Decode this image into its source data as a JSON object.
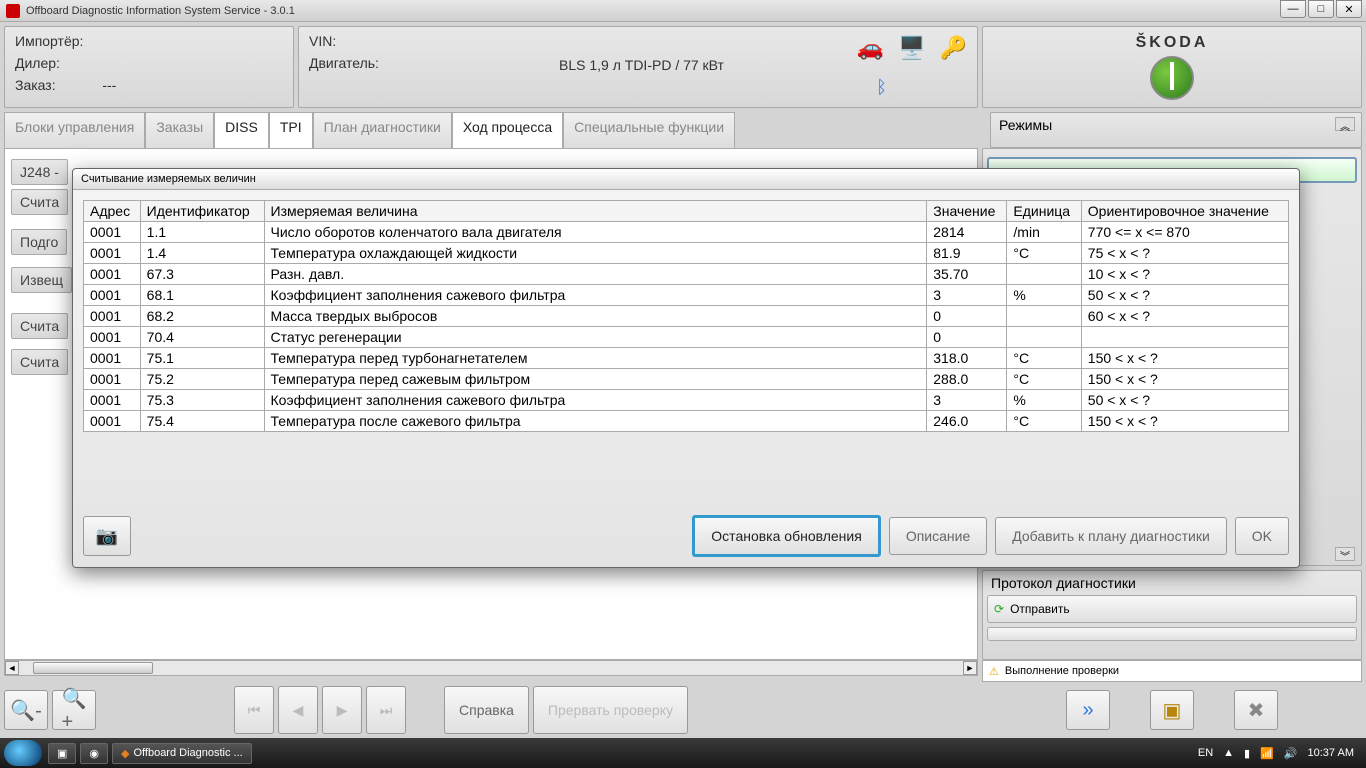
{
  "window": {
    "title": "Offboard Diagnostic Information System Service - 3.0.1"
  },
  "header": {
    "importer_label": "Импортёр:",
    "dealer_label": "Дилер:",
    "order_label": "Заказ:",
    "order_value": "---",
    "vin_label": "VIN:",
    "engine_label": "Двигатель:",
    "engine_value": "BLS 1,9 л TDI-PD / 77 кВт",
    "brand": "ŠKODA"
  },
  "tabs": {
    "control_units": "Блоки управления",
    "orders": "Заказы",
    "diss": "DISS",
    "tpi": "TPI",
    "diag_plan": "План диагностики",
    "process": "Ход процесса",
    "special": "Специальные функции"
  },
  "left_stubs": {
    "j248": "J248 -",
    "read": "Счита",
    "prep": "Подго",
    "notify": "Извещ",
    "read2": "Счита",
    "read3": "Счита"
  },
  "side": {
    "modes_title": "Режимы",
    "protocol_title": "Протокол диагностики",
    "send": "Отправить"
  },
  "bottom": {
    "help": "Справка",
    "stop_check": "Прервать проверку"
  },
  "status": {
    "exec_check": "Выполнение проверки"
  },
  "dialog": {
    "title": "Считывание измеряемых величин",
    "columns": {
      "addr": "Адрес",
      "id": "Идентификатор",
      "measure": "Измеряемая величина",
      "value": "Значение",
      "unit": "Единица",
      "ref": "Ориентировочное значение"
    },
    "rows": [
      {
        "addr": "0001",
        "id": "1.1",
        "measure": "Число оборотов коленчатого вала двигателя",
        "value": "2814",
        "unit": "/min",
        "ref": "770 <= x <= 870"
      },
      {
        "addr": "0001",
        "id": "1.4",
        "measure": "Температура охлаждающей жидкости",
        "value": "81.9",
        "unit": "°C",
        "ref": "75 < x < ?"
      },
      {
        "addr": "0001",
        "id": "67.3",
        "measure": "Разн. давл.",
        "value": "35.70",
        "unit": "",
        "ref": "10 < x < ?"
      },
      {
        "addr": "0001",
        "id": "68.1",
        "measure": "Коэффициент заполнения сажевого фильтра",
        "value": "3",
        "unit": "%",
        "ref": "50 < x < ?"
      },
      {
        "addr": "0001",
        "id": "68.2",
        "measure": "Масса твердых выбросов",
        "value": "0",
        "unit": "",
        "ref": "60 < x < ?"
      },
      {
        "addr": "0001",
        "id": "70.4",
        "measure": "Статус регенерации",
        "value": "0",
        "unit": "",
        "ref": ""
      },
      {
        "addr": "0001",
        "id": "75.1",
        "measure": "Температура перед турбонагнетателем",
        "value": "318.0",
        "unit": "°C",
        "ref": "150 < x < ?"
      },
      {
        "addr": "0001",
        "id": "75.2",
        "measure": "Температура перед сажевым фильтром",
        "value": "288.0",
        "unit": "°C",
        "ref": "150 < x < ?"
      },
      {
        "addr": "0001",
        "id": "75.3",
        "measure": "Коэффициент заполнения сажевого фильтра",
        "value": "3",
        "unit": "%",
        "ref": "50 < x < ?"
      },
      {
        "addr": "0001",
        "id": "75.4",
        "measure": "Температура после сажевого фильтра",
        "value": "246.0",
        "unit": "°C",
        "ref": "150 < x < ?"
      }
    ],
    "buttons": {
      "stop_update": "Остановка обновления",
      "description": "Описание",
      "add_to_plan": "Добавить к плану диагностики",
      "ok": "OK"
    }
  },
  "taskbar": {
    "app": "Offboard Diagnostic ...",
    "lang": "EN",
    "time": "10:37 AM"
  }
}
